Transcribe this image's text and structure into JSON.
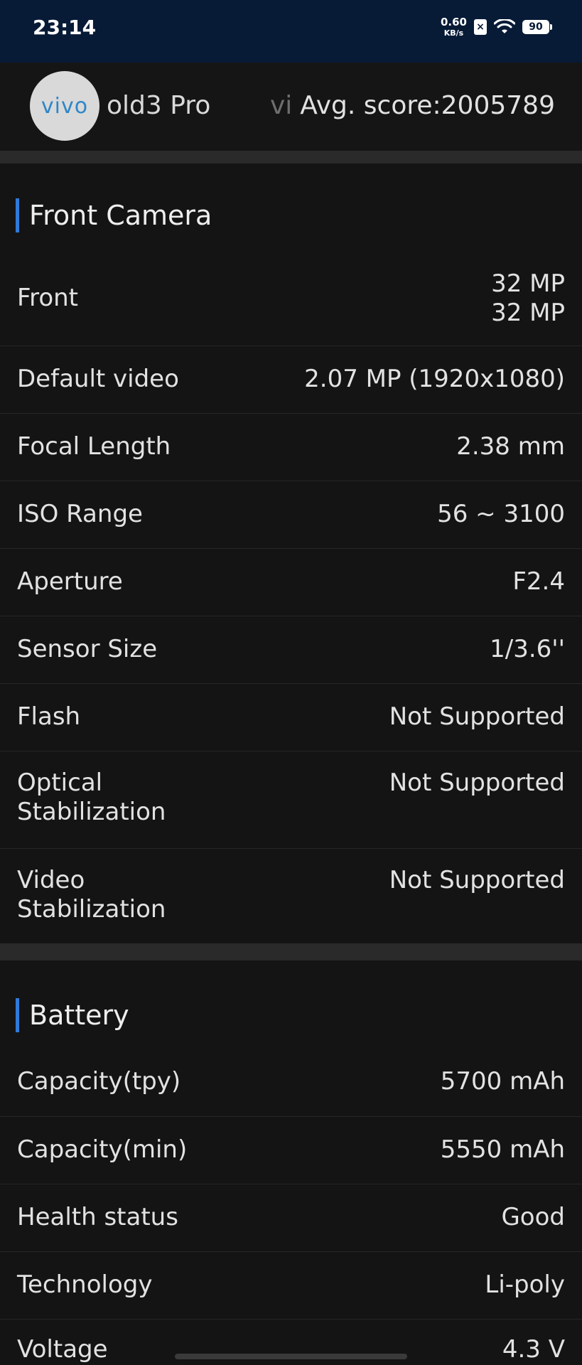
{
  "status_bar": {
    "time": "23:14",
    "net_speed_value": "0.60",
    "net_speed_unit": "KB/s",
    "sim_badge": "×",
    "battery_level": "90",
    "icons": [
      "sim-off-icon",
      "wifi-icon",
      "battery-icon"
    ]
  },
  "header": {
    "logo_text": "vivo",
    "device_name_visible": "old3 Pro",
    "device_name_next": "vi",
    "avg_score": "Avg. score:2005789"
  },
  "front_camera": {
    "title": "Front Camera",
    "rows": [
      {
        "label": "Front",
        "value": "32 MP\n32 MP"
      },
      {
        "label": "Default video",
        "value": "2.07 MP (1920x1080)"
      },
      {
        "label": "Focal Length",
        "value": "2.38 mm"
      },
      {
        "label": "ISO Range",
        "value": "56 ~ 3100"
      },
      {
        "label": "Aperture",
        "value": "F2.4"
      },
      {
        "label": "Sensor Size",
        "value": "1/3.6''"
      },
      {
        "label": "Flash",
        "value": "Not Supported"
      },
      {
        "label": "Optical\nStabilization",
        "value": "Not Supported"
      },
      {
        "label": "Video\nStabilization",
        "value": "Not Supported"
      }
    ]
  },
  "battery": {
    "title": "Battery",
    "rows": [
      {
        "label": "Capacity(tpy)",
        "value": "5700 mAh"
      },
      {
        "label": "Capacity(min)",
        "value": "5550 mAh"
      },
      {
        "label": "Health status",
        "value": "Good"
      },
      {
        "label": "Technology",
        "value": "Li-poly"
      },
      {
        "label": "Voltage",
        "value": "4.3 V"
      }
    ]
  },
  "colors": {
    "accent": "#2f7ad8",
    "status_bar_bg": "#071a36",
    "background": "#141414"
  }
}
